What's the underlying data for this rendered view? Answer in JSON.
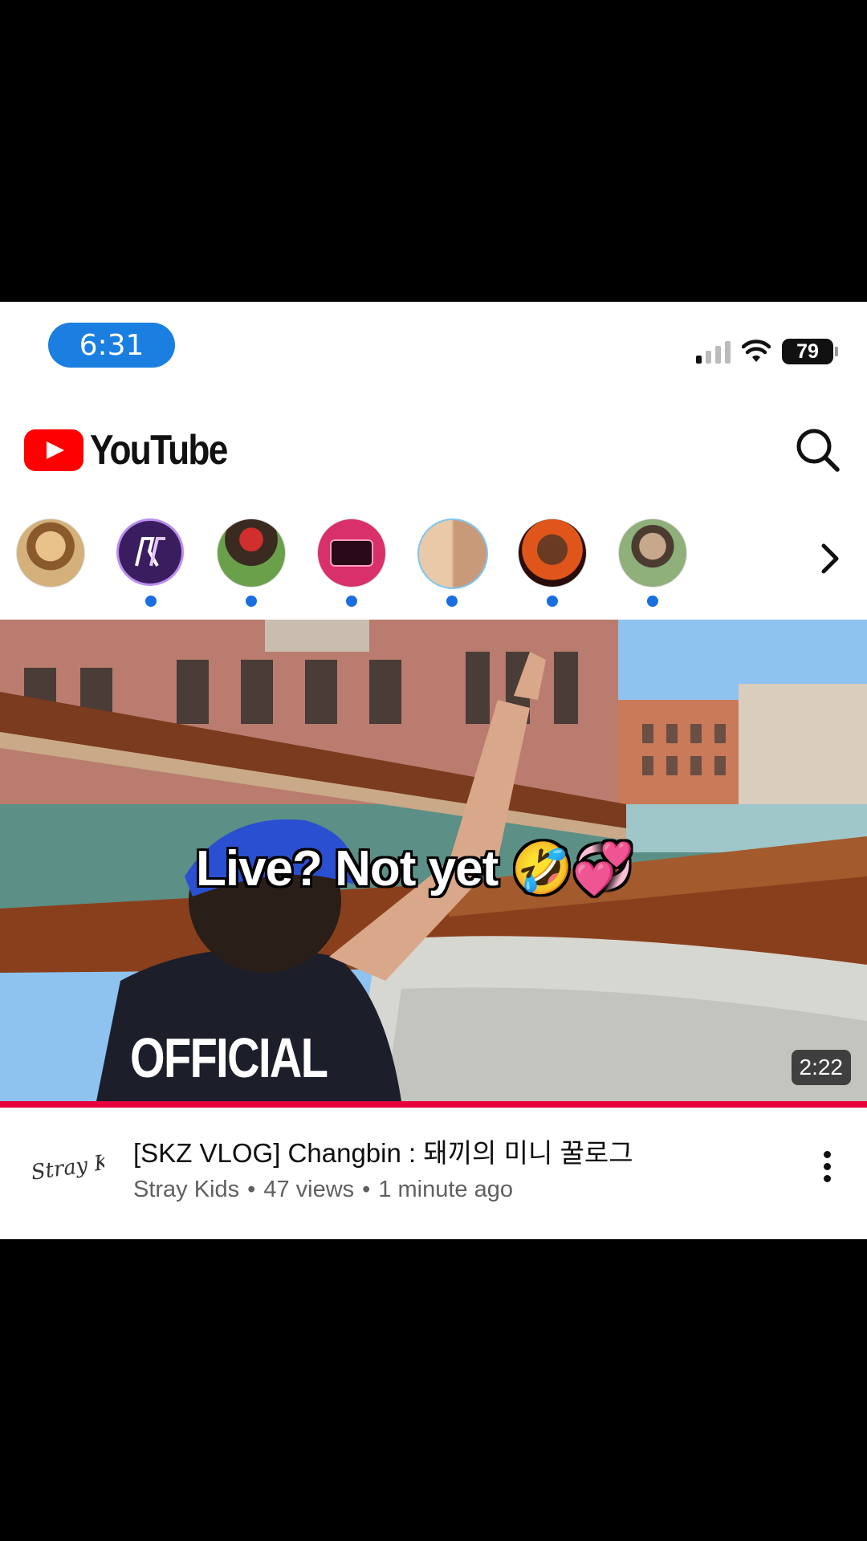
{
  "status_bar": {
    "time": "6:31",
    "battery": "79"
  },
  "header": {
    "brand": "YouTube"
  },
  "subscriptions": {
    "count_shown": 7
  },
  "video": {
    "caption": "Live? Not yet 🤣💞",
    "watermark_text": "OFFICIAL",
    "duration": "2:22",
    "title": "[SKZ VLOG] Changbin : 돼끼의 미니 꿀로그",
    "channel": "Stray Kids",
    "views": "47 views",
    "age": "1 minute ago",
    "progress": 1.0
  },
  "colors": {
    "brand_red": "#ff0000",
    "progress_red": "#e8003d",
    "unread_dot": "#1a6fe0",
    "time_pill": "#1a7fe0"
  }
}
